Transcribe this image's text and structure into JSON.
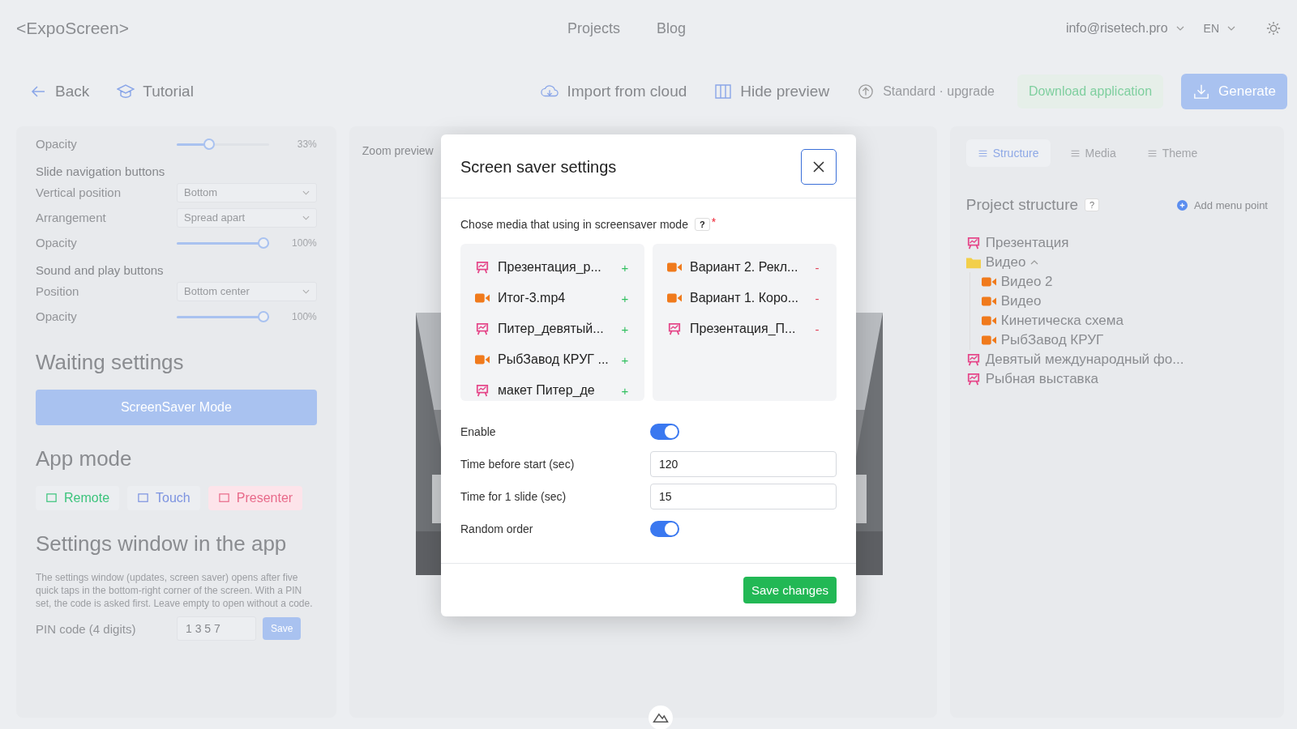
{
  "header": {
    "logo": "<ExpoScreen>",
    "nav": [
      "Projects",
      "Blog"
    ],
    "account": "info@risetech.pro",
    "language": "EN"
  },
  "toolbar": {
    "back": "Back",
    "tutorial": "Tutorial",
    "import": "Import from cloud",
    "hide_preview": "Hide preview",
    "plan": "Standard · upgrade",
    "download": "Download application",
    "generate": "Generate"
  },
  "settings_panel": {
    "rows": [
      {
        "kind": "slider",
        "label": "Opacity",
        "level": 0.33,
        "reading": "33%"
      },
      {
        "kind": "heading",
        "label": "Slide navigation buttons"
      },
      {
        "kind": "select",
        "label": "Vertical position",
        "value": "Bottom"
      },
      {
        "kind": "select",
        "label": "Arrangement",
        "value": "Spread apart"
      },
      {
        "kind": "slider",
        "label": "Opacity",
        "level": 1,
        "reading": "100%"
      },
      {
        "kind": "heading",
        "label": "Sound and play buttons"
      },
      {
        "kind": "select",
        "label": "Position",
        "value": "Bottom center"
      },
      {
        "kind": "slider",
        "label": "Opacity",
        "level": 1,
        "reading": "100%"
      }
    ],
    "waiting_title": "Waiting settings",
    "screensaver_button": "ScreenSaver Mode",
    "app_mode_title": "App mode",
    "modes": [
      {
        "label": "Remote",
        "selected": false,
        "color": "#3cc47c"
      },
      {
        "label": "Touch",
        "selected": false,
        "color": "#7c93e0"
      },
      {
        "label": "Presenter",
        "selected": true,
        "color": "#e86a8a"
      }
    ],
    "settings_window_title": "Settings window in the app",
    "description": "The settings window (updates, screen saver) opens after five quick taps in the bottom-right corner of the screen. With a PIN set, the code is asked first. Leave empty to open without a code.",
    "pin_label": "PIN code (4 digits)",
    "pin_value": "1 3 5 7",
    "pin_save": "Save"
  },
  "preview": {
    "label": "Zoom preview"
  },
  "structure_panel": {
    "tabs": [
      {
        "label": "Structure",
        "selected": true
      },
      {
        "label": "Media",
        "selected": false
      },
      {
        "label": "Theme",
        "selected": false
      }
    ],
    "title": "Project structure",
    "help": "?",
    "add": "Add menu point",
    "tree": [
      {
        "kind": "presentation",
        "label": "Презентация"
      },
      {
        "kind": "folder",
        "label": "Видео",
        "expanded": true,
        "children": [
          {
            "kind": "video",
            "label": "Видео 2"
          },
          {
            "kind": "video",
            "label": "Видео"
          },
          {
            "kind": "video",
            "label": "Кинетическа схема"
          },
          {
            "kind": "video",
            "label": "РыбЗавод КРУГ"
          }
        ]
      },
      {
        "kind": "presentation",
        "label": "Девятый международный фо..."
      },
      {
        "kind": "presentation",
        "label": "Рыбная выставка"
      }
    ]
  },
  "dialog": {
    "title": "Screen saver settings",
    "prompt": "Chose media that using in screensaver mode",
    "help": "?",
    "required": "*",
    "available": [
      {
        "kind": "presentation",
        "label": "Презентация_р...",
        "action": "+"
      },
      {
        "kind": "video",
        "label": "Итог-3.mp4",
        "action": "+"
      },
      {
        "kind": "presentation",
        "label": "Питер_девятый...",
        "action": "+"
      },
      {
        "kind": "video",
        "label": "РыбЗавод КРУГ ...",
        "action": "+"
      },
      {
        "kind": "presentation",
        "label": "макет Питер_де",
        "action": "+"
      }
    ],
    "chosen": [
      {
        "kind": "video",
        "label": "Вариант 2. Рекл...",
        "action": "-"
      },
      {
        "kind": "video",
        "label": "Вариант 1. Коро...",
        "action": "-"
      },
      {
        "kind": "presentation",
        "label": "Презентация_П...",
        "action": "-"
      }
    ],
    "enable_label": "Enable",
    "enable_on": true,
    "start_label": "Time before start (sec)",
    "start_value": "120",
    "slide_label": "Time for 1 slide (sec)",
    "slide_value": "15",
    "random_label": "Random order",
    "random_on": true,
    "save": "Save changes"
  }
}
